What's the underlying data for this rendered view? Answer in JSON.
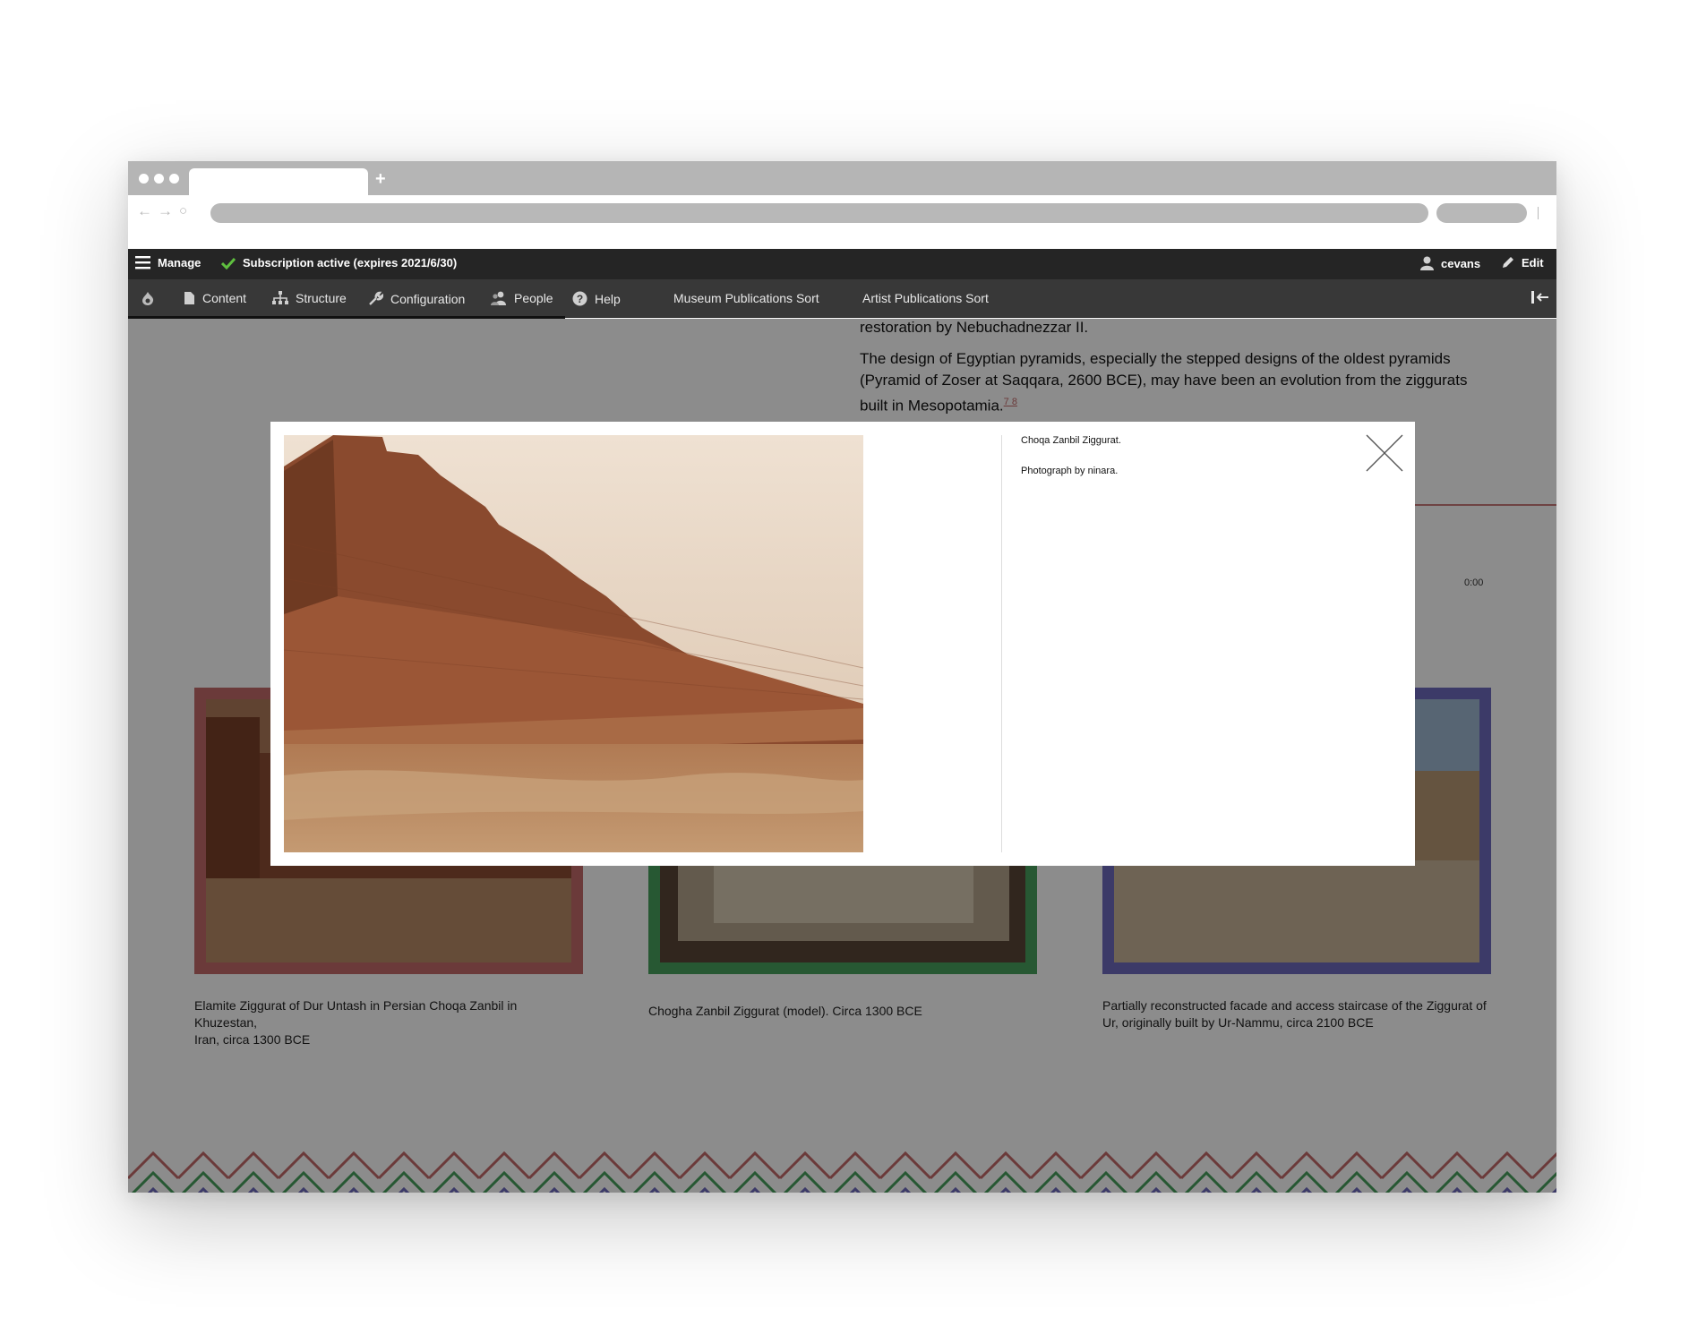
{
  "admin_toolbar": {
    "manage_label": "Manage",
    "subscription_status": "Subscription active (expires 2021/6/30)",
    "user_name": "cevans",
    "edit_label": "Edit",
    "menu": {
      "content": "Content",
      "structure": "Structure",
      "configuration": "Configuration",
      "people": "People",
      "help": "Help",
      "museum_pubs": "Museum Publications Sort",
      "artist_pubs": "Artist Publications Sort"
    }
  },
  "article": {
    "line_top": "restoration by Nebuchadnezzar II.",
    "paragraph_lines": [
      "The design of Egyptian pyramids, especially the stepped designs of the oldest pyramids",
      "(Pyramid of Zoser at Saqqara, 2600 BCE), may have been an evolution from the ziggurats",
      "built in Mesopotamia."
    ],
    "footnote": "7 8",
    "timer": "0:00"
  },
  "gallery": [
    {
      "caption_lines": [
        "Elamite Ziggurat of Dur Untash in Persian Choqa Zanbil in Khuzestan,",
        "Iran, circa 1300 BCE"
      ],
      "frame_color": "#c46b6b"
    },
    {
      "caption_lines": [
        "Chogha Zanbil Ziggurat (model). Circa 1300 BCE"
      ],
      "frame_color": "#47a15e"
    },
    {
      "caption_lines": [
        "Partially reconstructed facade and access staircase of the Ziggurat of",
        "Ur, originally built by Ur-Nammu, circa 2100 BCE"
      ],
      "frame_color": "#6e6abd"
    }
  ],
  "modal": {
    "caption_title": "Choqa Zanbil Ziggurat.",
    "caption_credit": "Photograph by ninara.",
    "close_icon": "close-icon"
  },
  "colors": {
    "toolbar_top": "#252525",
    "toolbar_bottom": "#383838",
    "check_green": "#5fbf3f",
    "zigzag": [
      "#c46b6b",
      "#47a15e",
      "#6e6abd"
    ]
  }
}
